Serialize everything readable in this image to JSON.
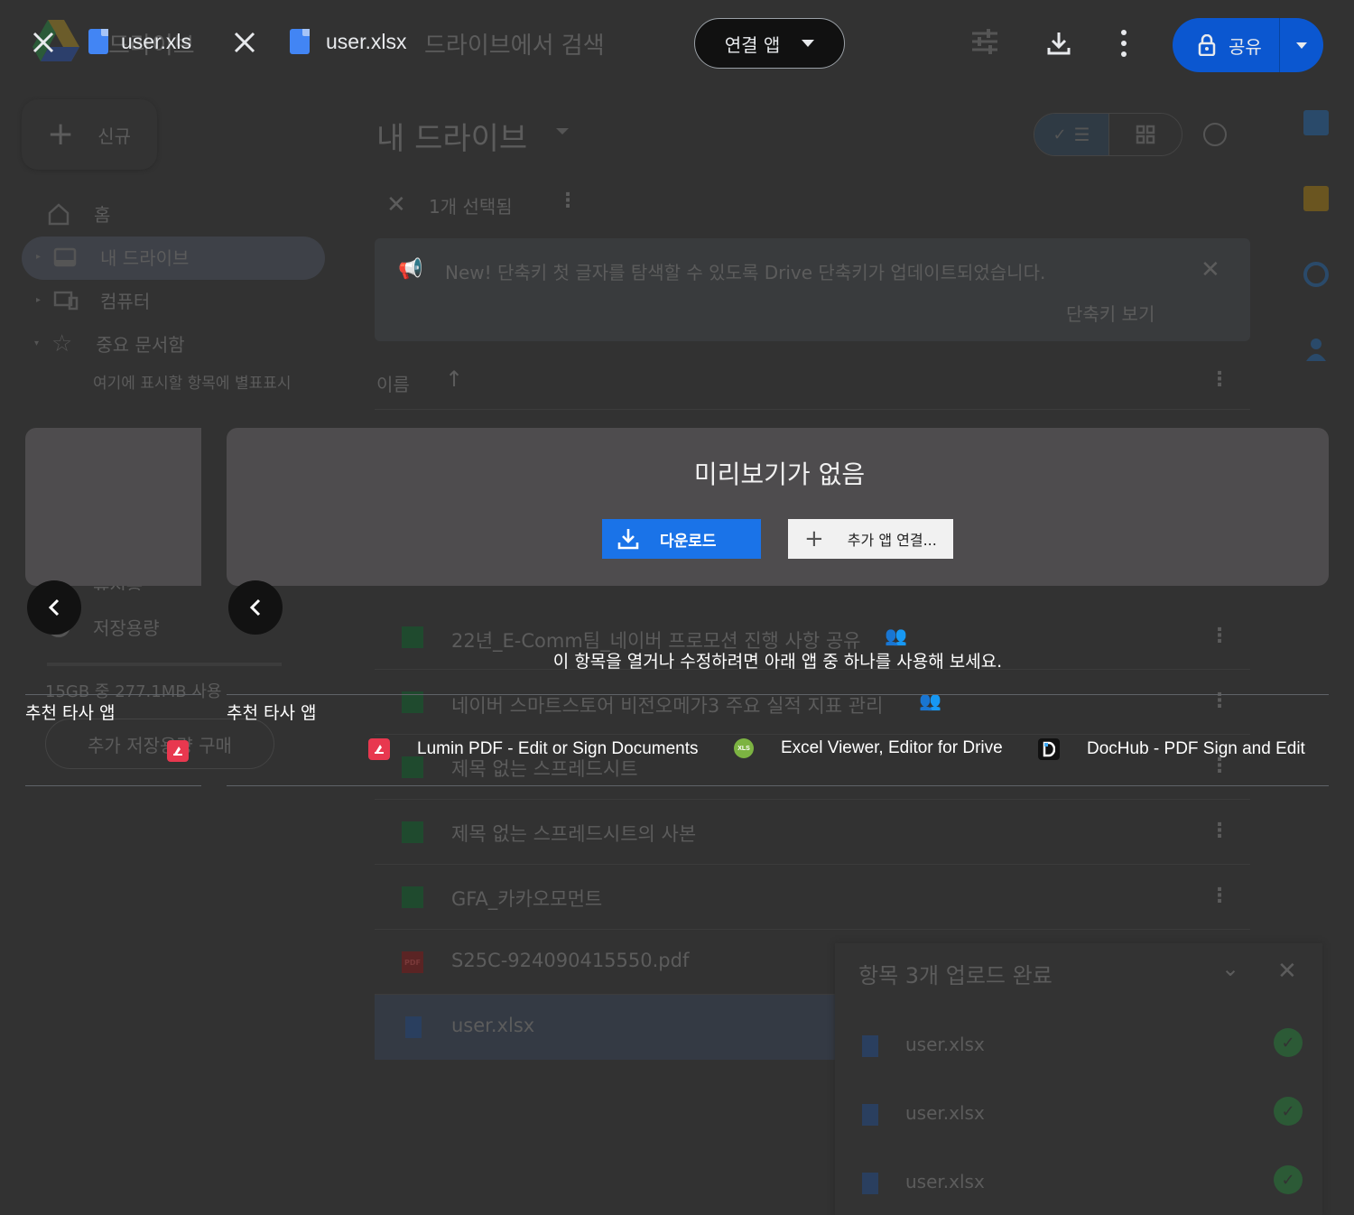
{
  "drive": {
    "search_placeholder": "드라이브에서 검색",
    "logo_text": "드라이브",
    "new_button": "신규",
    "nav": [
      {
        "label": "홈",
        "icon": "home-icon"
      },
      {
        "label": "내 드라이브",
        "icon": "drive-icon"
      },
      {
        "label": "컴퓨터",
        "icon": "computer-icon"
      },
      {
        "label": "중요 문서함",
        "icon": "star-icon"
      }
    ],
    "starred_hint": "여기에 표시할 항목에 별표표시",
    "nav_partial": "휴지통",
    "storage_label": "저장용량",
    "storage_usage": "15GB 중 277.1MB 사용",
    "buy_storage": "추가 저장용량 구매",
    "page_title": "내 드라이브",
    "selection_text": "1개 선택됨",
    "banner_text": "New! 단축키 첫 글자를 탐색할 수 있도록 Drive 단축키가 업데이트되었습니다.",
    "banner_link": "단축키 보기",
    "sort_label": "이름",
    "files": [
      {
        "name": "22년_E-Comm팀_네이버 프로모션 진행 사항 공유",
        "type": "sheet",
        "shared": true
      },
      {
        "name": "네이버 스마트스토어 비전오메가3 주요 실적 지표 관리",
        "type": "sheet",
        "shared": true
      },
      {
        "name": "제목 없는 스프레드시트",
        "type": "sheet",
        "shared": false
      },
      {
        "name": "제목 없는 스프레드시트의 사본",
        "type": "sheet",
        "shared": false
      },
      {
        "name": "GFA_카카오모먼트",
        "type": "sheet-shortcut",
        "shared": false
      },
      {
        "name": "S25C-924090415550.pdf",
        "type": "pdf",
        "shared": false
      },
      {
        "name": "user.xlsx",
        "type": "doc",
        "shared": false
      }
    ],
    "upload_panel": {
      "title": "항목 3개 업로드 완료",
      "items": [
        "user.xlsx",
        "user.xlsx",
        "user.xlsx"
      ]
    },
    "pdf_badge": "PDF"
  },
  "viewer": {
    "tabs": [
      {
        "name": "user.xls"
      },
      {
        "name": "user.xlsx"
      }
    ],
    "open_with_label": "연결 앱",
    "share_label": "공유",
    "no_preview_title": "미리보기가 없음",
    "download_label": "다운로드",
    "connect_more_label": "추가 앱 연결...",
    "try_apps_text": "이 항목을 열거나 수정하려면 아래 앱 중 하나를 사용해 보세요.",
    "recommended_label": "추천 타사 앱",
    "apps": [
      {
        "name": "Lumin PDF - Edit or Sign Documents",
        "color": "#e8384f"
      },
      {
        "name": "Excel Viewer, Editor for Drive",
        "color": "#7cb342",
        "badge": "XLS"
      },
      {
        "name": "DocHub - PDF Sign and Edit",
        "color": "#111111"
      }
    ]
  },
  "colors": {
    "accent": "#1a73e8",
    "share": "#0b57d0",
    "background": "#323232",
    "panel": "#4e4c4e"
  }
}
